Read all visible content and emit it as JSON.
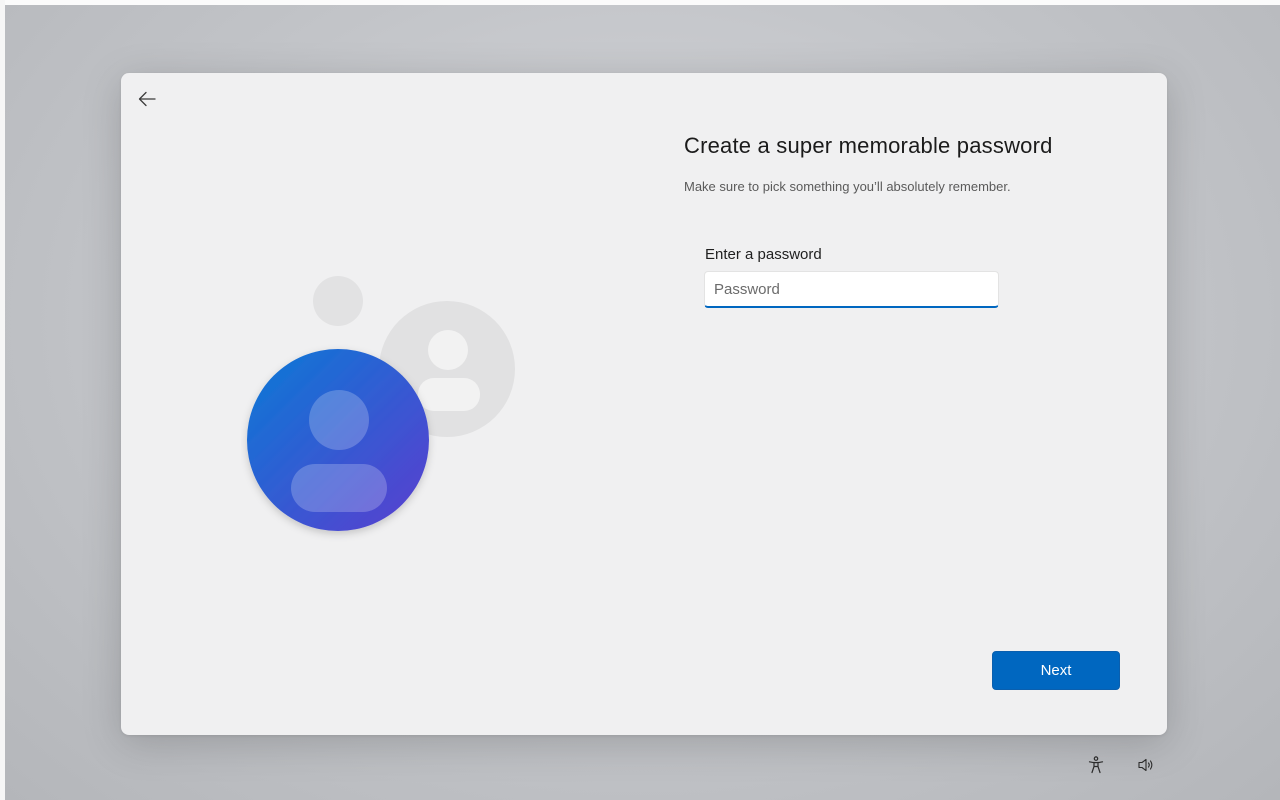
{
  "header": {
    "back_icon": "arrow-left-icon",
    "title": "Create a super memorable password",
    "subtitle": "Make sure to pick something you’ll absolutely remember."
  },
  "password_field": {
    "label": "Enter a password",
    "value": "",
    "placeholder": "Password"
  },
  "actions": {
    "next_label": "Next"
  },
  "illustration": {
    "icon": "user-accounts-icon"
  },
  "system_tray": {
    "accessibility_icon": "accessibility-icon",
    "volume_icon": "volume-icon"
  },
  "colors": {
    "accent": "#0067c0",
    "card_background": "#f0f0f1",
    "avatar_gradient_start": "#0a78d4",
    "avatar_gradient_end": "#5b3fd0"
  }
}
